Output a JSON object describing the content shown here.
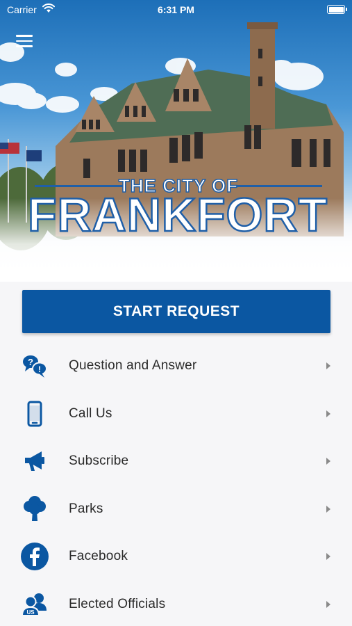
{
  "status_bar": {
    "carrier": "Carrier",
    "time": "6:31 PM"
  },
  "header": {
    "logo_small_text": "THE CITY OF",
    "logo_main_text": "FRANKFORT",
    "menu_icon": "hamburger-menu-icon"
  },
  "start_request": {
    "label": "START REQUEST"
  },
  "menu": [
    {
      "label": "Question and Answer",
      "icon": "question-bubbles-icon"
    },
    {
      "label": "Call Us",
      "icon": "phone-icon"
    },
    {
      "label": "Subscribe",
      "icon": "megaphone-icon"
    },
    {
      "label": "Parks",
      "icon": "tree-icon"
    },
    {
      "label": "Facebook",
      "icon": "facebook-icon"
    },
    {
      "label": "Elected Officials",
      "icon": "people-icon"
    }
  ],
  "colors": {
    "brand_blue": "#0b57a2",
    "icon_blue": "#0b57a2",
    "text": "#2a2a2a",
    "background": "#f6f6f8"
  }
}
